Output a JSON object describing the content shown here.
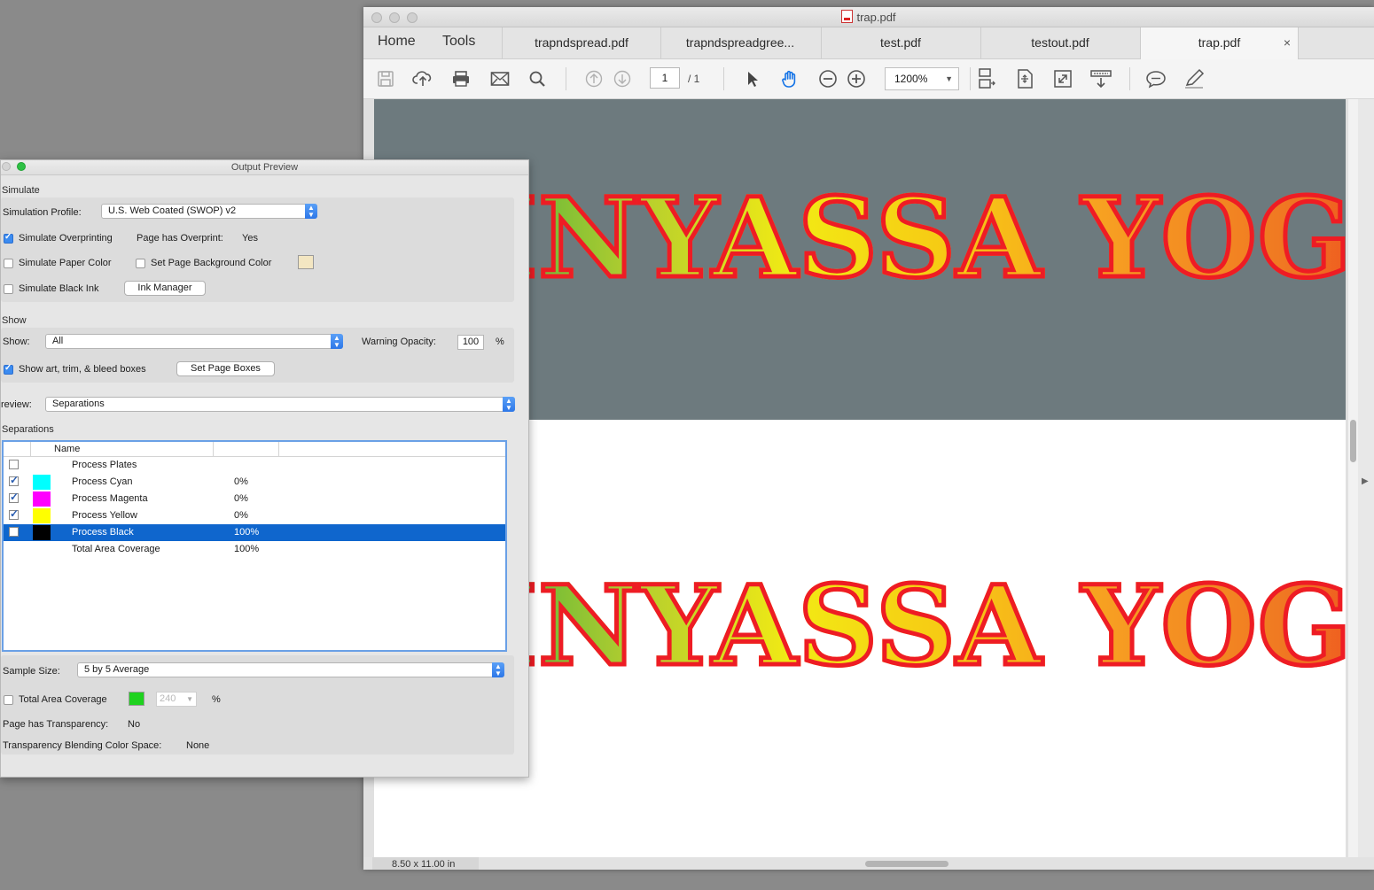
{
  "acrobat": {
    "title": "trap.pdf",
    "nav": {
      "home": "Home",
      "tools": "Tools"
    },
    "tabs": [
      {
        "label": "trapndspread.pdf",
        "active": false
      },
      {
        "label": "trapndspreadgree...",
        "active": false
      },
      {
        "label": "test.pdf",
        "active": false
      },
      {
        "label": "testout.pdf",
        "active": false
      },
      {
        "label": "trap.pdf",
        "active": true
      }
    ],
    "tab_close": "×",
    "toolbar": {
      "page_current": "1",
      "page_total": "/ 1",
      "zoom": "1200%",
      "icons": [
        "save-icon",
        "upload-icon",
        "print-icon",
        "email-icon",
        "search-icon",
        "page-up-icon",
        "page-down-icon",
        "select-cursor-icon",
        "hand-tool-icon",
        "zoom-out-icon",
        "zoom-in-icon",
        "scroll-mode-icon",
        "fit-page-icon",
        "full-screen-icon",
        "read-mode-icon",
        "comment-icon",
        "sign-icon"
      ]
    },
    "document": {
      "text_top": "WINYASSA YOGA",
      "text_bottom": "WINYASSA YOGA",
      "page_size": "8.50 x 11.00 in"
    }
  },
  "output_preview": {
    "title": "Output Preview",
    "simulate": {
      "header": "Simulate",
      "profile_label": "Simulation Profile:",
      "profile_value": "U.S. Web Coated (SWOP) v2",
      "overprinting_label": "Simulate Overprinting",
      "overprinting_checked": true,
      "page_overprint_label": "Page has Overprint:",
      "page_overprint_value": "Yes",
      "paper_color_label": "Simulate Paper Color",
      "bg_color_label": "Set Page Background Color",
      "black_ink_label": "Simulate Black Ink",
      "ink_manager_label": "Ink Manager"
    },
    "show": {
      "header": "Show",
      "show_label": "Show:",
      "show_value": "All",
      "warning_label": "Warning Opacity:",
      "warning_value": "100",
      "warning_unit": "%",
      "boxes_label": "Show art, trim, & bleed boxes",
      "boxes_checked": true,
      "set_boxes_label": "Set Page Boxes"
    },
    "preview": {
      "label": "review:",
      "value": "Separations"
    },
    "separations": {
      "header": "Separations",
      "column_name": "Name",
      "rows": [
        {
          "checked": false,
          "swatch": "",
          "name": "Process Plates",
          "percent": "",
          "selected": false
        },
        {
          "checked": true,
          "swatch": "#00ffff",
          "name": "Process Cyan",
          "percent": "0%",
          "selected": false
        },
        {
          "checked": true,
          "swatch": "#ff00ff",
          "name": "Process Magenta",
          "percent": "0%",
          "selected": false
        },
        {
          "checked": true,
          "swatch": "#ffff00",
          "name": "Process Yellow",
          "percent": "0%",
          "selected": false
        },
        {
          "checked": false,
          "swatch": "#000000",
          "name": "Process Black",
          "percent": "100%",
          "selected": true
        },
        {
          "checked": null,
          "swatch": "",
          "name": "Total Area Coverage",
          "percent": "100%",
          "selected": false
        }
      ]
    },
    "sample": {
      "label": "Sample Size:",
      "value": "5 by 5 Average"
    },
    "coverage": {
      "label": "Total Area Coverage",
      "value": "240",
      "unit": "%",
      "swatch": "#1fd21f"
    },
    "transparency": {
      "label": "Page has Transparency:",
      "value": "No",
      "blend_label": "Transparency Blending Color Space:",
      "blend_value": "None"
    }
  }
}
